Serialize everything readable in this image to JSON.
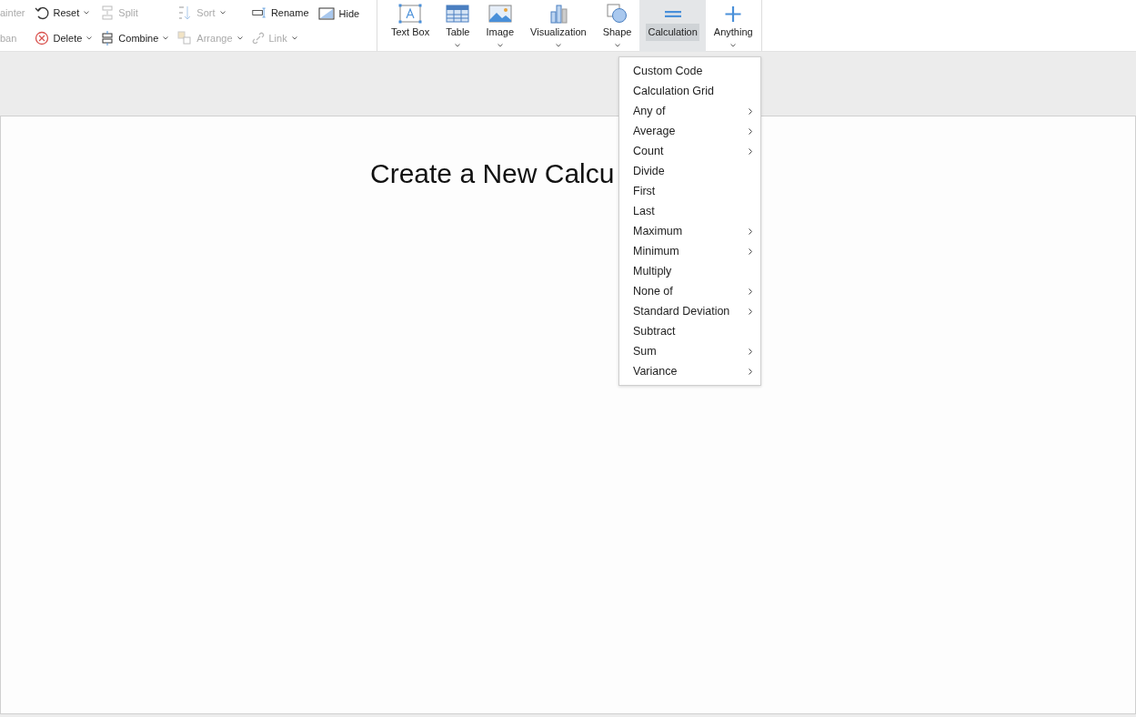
{
  "toolbar": {
    "small_columns": [
      [
        {
          "label": "ainter",
          "disabled": true,
          "caret": false
        },
        {
          "label": "ban",
          "disabled": true,
          "caret": false
        }
      ],
      [
        {
          "label": "Reset",
          "disabled": false,
          "caret": true
        },
        {
          "label": "Delete",
          "disabled": false,
          "caret": true
        }
      ],
      [
        {
          "label": "Split",
          "disabled": true,
          "caret": false
        },
        {
          "label": "Combine",
          "disabled": false,
          "caret": true
        }
      ],
      [
        {
          "label": "Sort",
          "disabled": true,
          "caret": true
        },
        {
          "label": "Arrange",
          "disabled": true,
          "caret": true
        }
      ],
      [
        {
          "label": "Rename",
          "disabled": false,
          "caret": false
        },
        {
          "label": "Link",
          "disabled": true,
          "caret": true
        }
      ],
      [
        {
          "label": "Hide",
          "disabled": false,
          "caret": false
        }
      ]
    ],
    "insert_buttons": [
      {
        "label": "Text Box",
        "caret": false,
        "selected": false
      },
      {
        "label": "Table",
        "caret": true,
        "selected": false
      },
      {
        "label": "Image",
        "caret": true,
        "selected": false
      },
      {
        "label": "Visualization",
        "caret": true,
        "selected": false
      },
      {
        "label": "Shape",
        "caret": true,
        "selected": false
      },
      {
        "label": "Calculation",
        "caret": false,
        "selected": true
      },
      {
        "label": "Anything",
        "caret": true,
        "selected": false
      }
    ]
  },
  "menu": {
    "items": [
      {
        "label": "Custom Code",
        "submenu": false
      },
      {
        "label": "Calculation Grid",
        "submenu": false
      },
      {
        "label": "Any of",
        "submenu": true
      },
      {
        "label": "Average",
        "submenu": true
      },
      {
        "label": "Count",
        "submenu": true
      },
      {
        "label": "Divide",
        "submenu": false
      },
      {
        "label": "First",
        "submenu": false
      },
      {
        "label": "Last",
        "submenu": false
      },
      {
        "label": "Maximum",
        "submenu": true
      },
      {
        "label": "Minimum",
        "submenu": true
      },
      {
        "label": "Multiply",
        "submenu": false
      },
      {
        "label": "None of",
        "submenu": true
      },
      {
        "label": "Standard Deviation",
        "submenu": true
      },
      {
        "label": "Subtract",
        "submenu": false
      },
      {
        "label": "Sum",
        "submenu": true
      },
      {
        "label": "Variance",
        "submenu": true
      }
    ]
  },
  "page": {
    "title": "Create a New Calcu"
  }
}
